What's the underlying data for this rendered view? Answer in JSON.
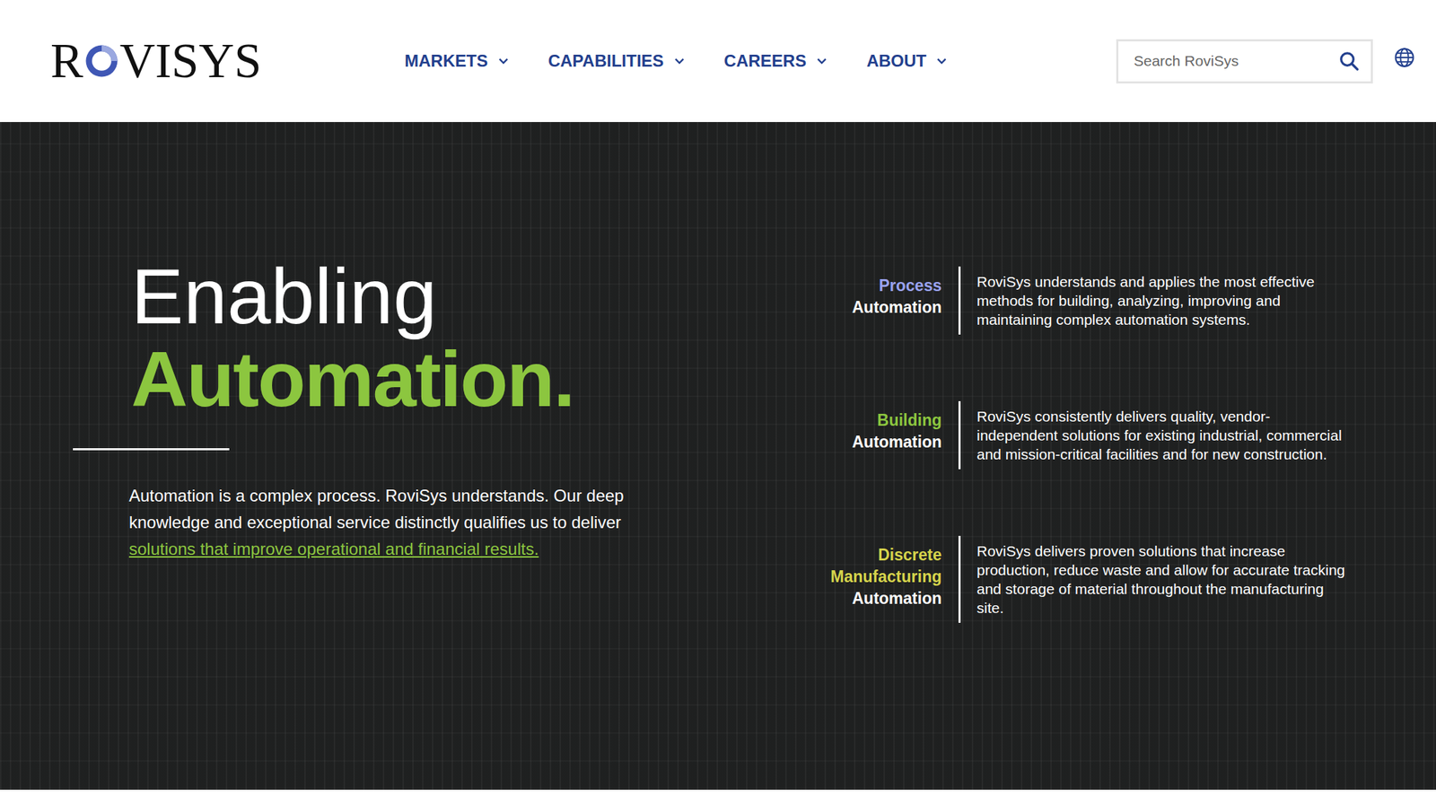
{
  "header": {
    "logo": {
      "before": "R",
      "after": "VISYS"
    },
    "nav": [
      {
        "label": "MARKETS"
      },
      {
        "label": "CAPABILITIES"
      },
      {
        "label": "CAREERS"
      },
      {
        "label": "ABOUT"
      }
    ],
    "search": {
      "placeholder": "Search RoviSys"
    }
  },
  "hero": {
    "title_line1": "Enabling",
    "title_line2": "Automation.",
    "paragraph": {
      "text": "Automation is a complex process. RoviSys understands. Our deep knowledge and exceptional service distinctly qualifies us to deliver ",
      "link": "solutions that improve operational and financial results."
    },
    "services": [
      {
        "title": "Process",
        "subtitle": "Automation",
        "color": "#9aa3f0",
        "description": "RoviSys understands and applies the most effective methods for building, analyzing, improving and maintaining complex automation systems."
      },
      {
        "title": "Building",
        "subtitle": "Automation",
        "color": "#8cc63f",
        "description": "RoviSys consistently delivers quality, vendor-independent solutions for existing industrial, commercial and mission-critical facilities and for new construction."
      },
      {
        "title": "Discrete Manufacturing",
        "subtitle": "Automation",
        "color": "#d6d44c",
        "description": "RoviSys delivers proven solutions that increase production, reduce waste and allow for accurate tracking and storage of material throughout the manufacturing site."
      }
    ]
  }
}
